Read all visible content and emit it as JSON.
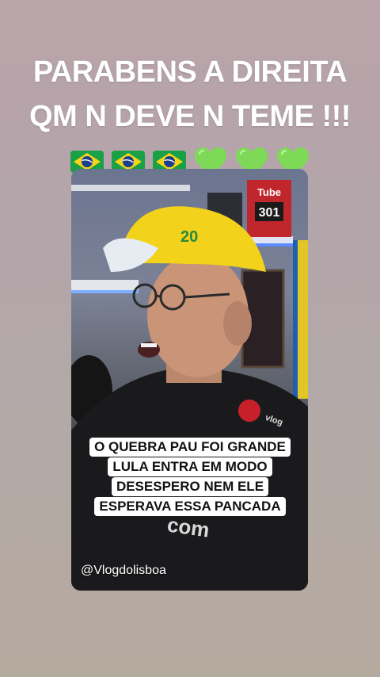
{
  "story": {
    "line1": "PARABENS A DIREITA",
    "line2": "QM N DEVE N TEME !!!",
    "emojis": [
      "brazil-flag",
      "brazil-flag",
      "brazil-flag",
      "green-heart",
      "green-heart",
      "green-heart"
    ]
  },
  "video": {
    "caption_lines": [
      "O QUEBRA PAU FOI GRANDE",
      "LULA ENTRA EM MODO",
      "DESESPERO NEM ELE",
      "ESPERAVA ESSA PANCADA"
    ],
    "watermark": "@Vlogdolisboa",
    "background_props": {
      "book_title": "Tube",
      "book_number": "301",
      "shirt_logo": "Vlog do Lisboa",
      "cap_text": "20"
    }
  },
  "colors": {
    "background_top": "#b9a4a9",
    "background_bottom": "#b4aa9e",
    "cap_yellow": "#f2d21a",
    "flag_green": "#1aa046",
    "flag_yellow": "#f7d417",
    "flag_blue": "#1a3f8f",
    "heart_green": "#7ed957"
  }
}
